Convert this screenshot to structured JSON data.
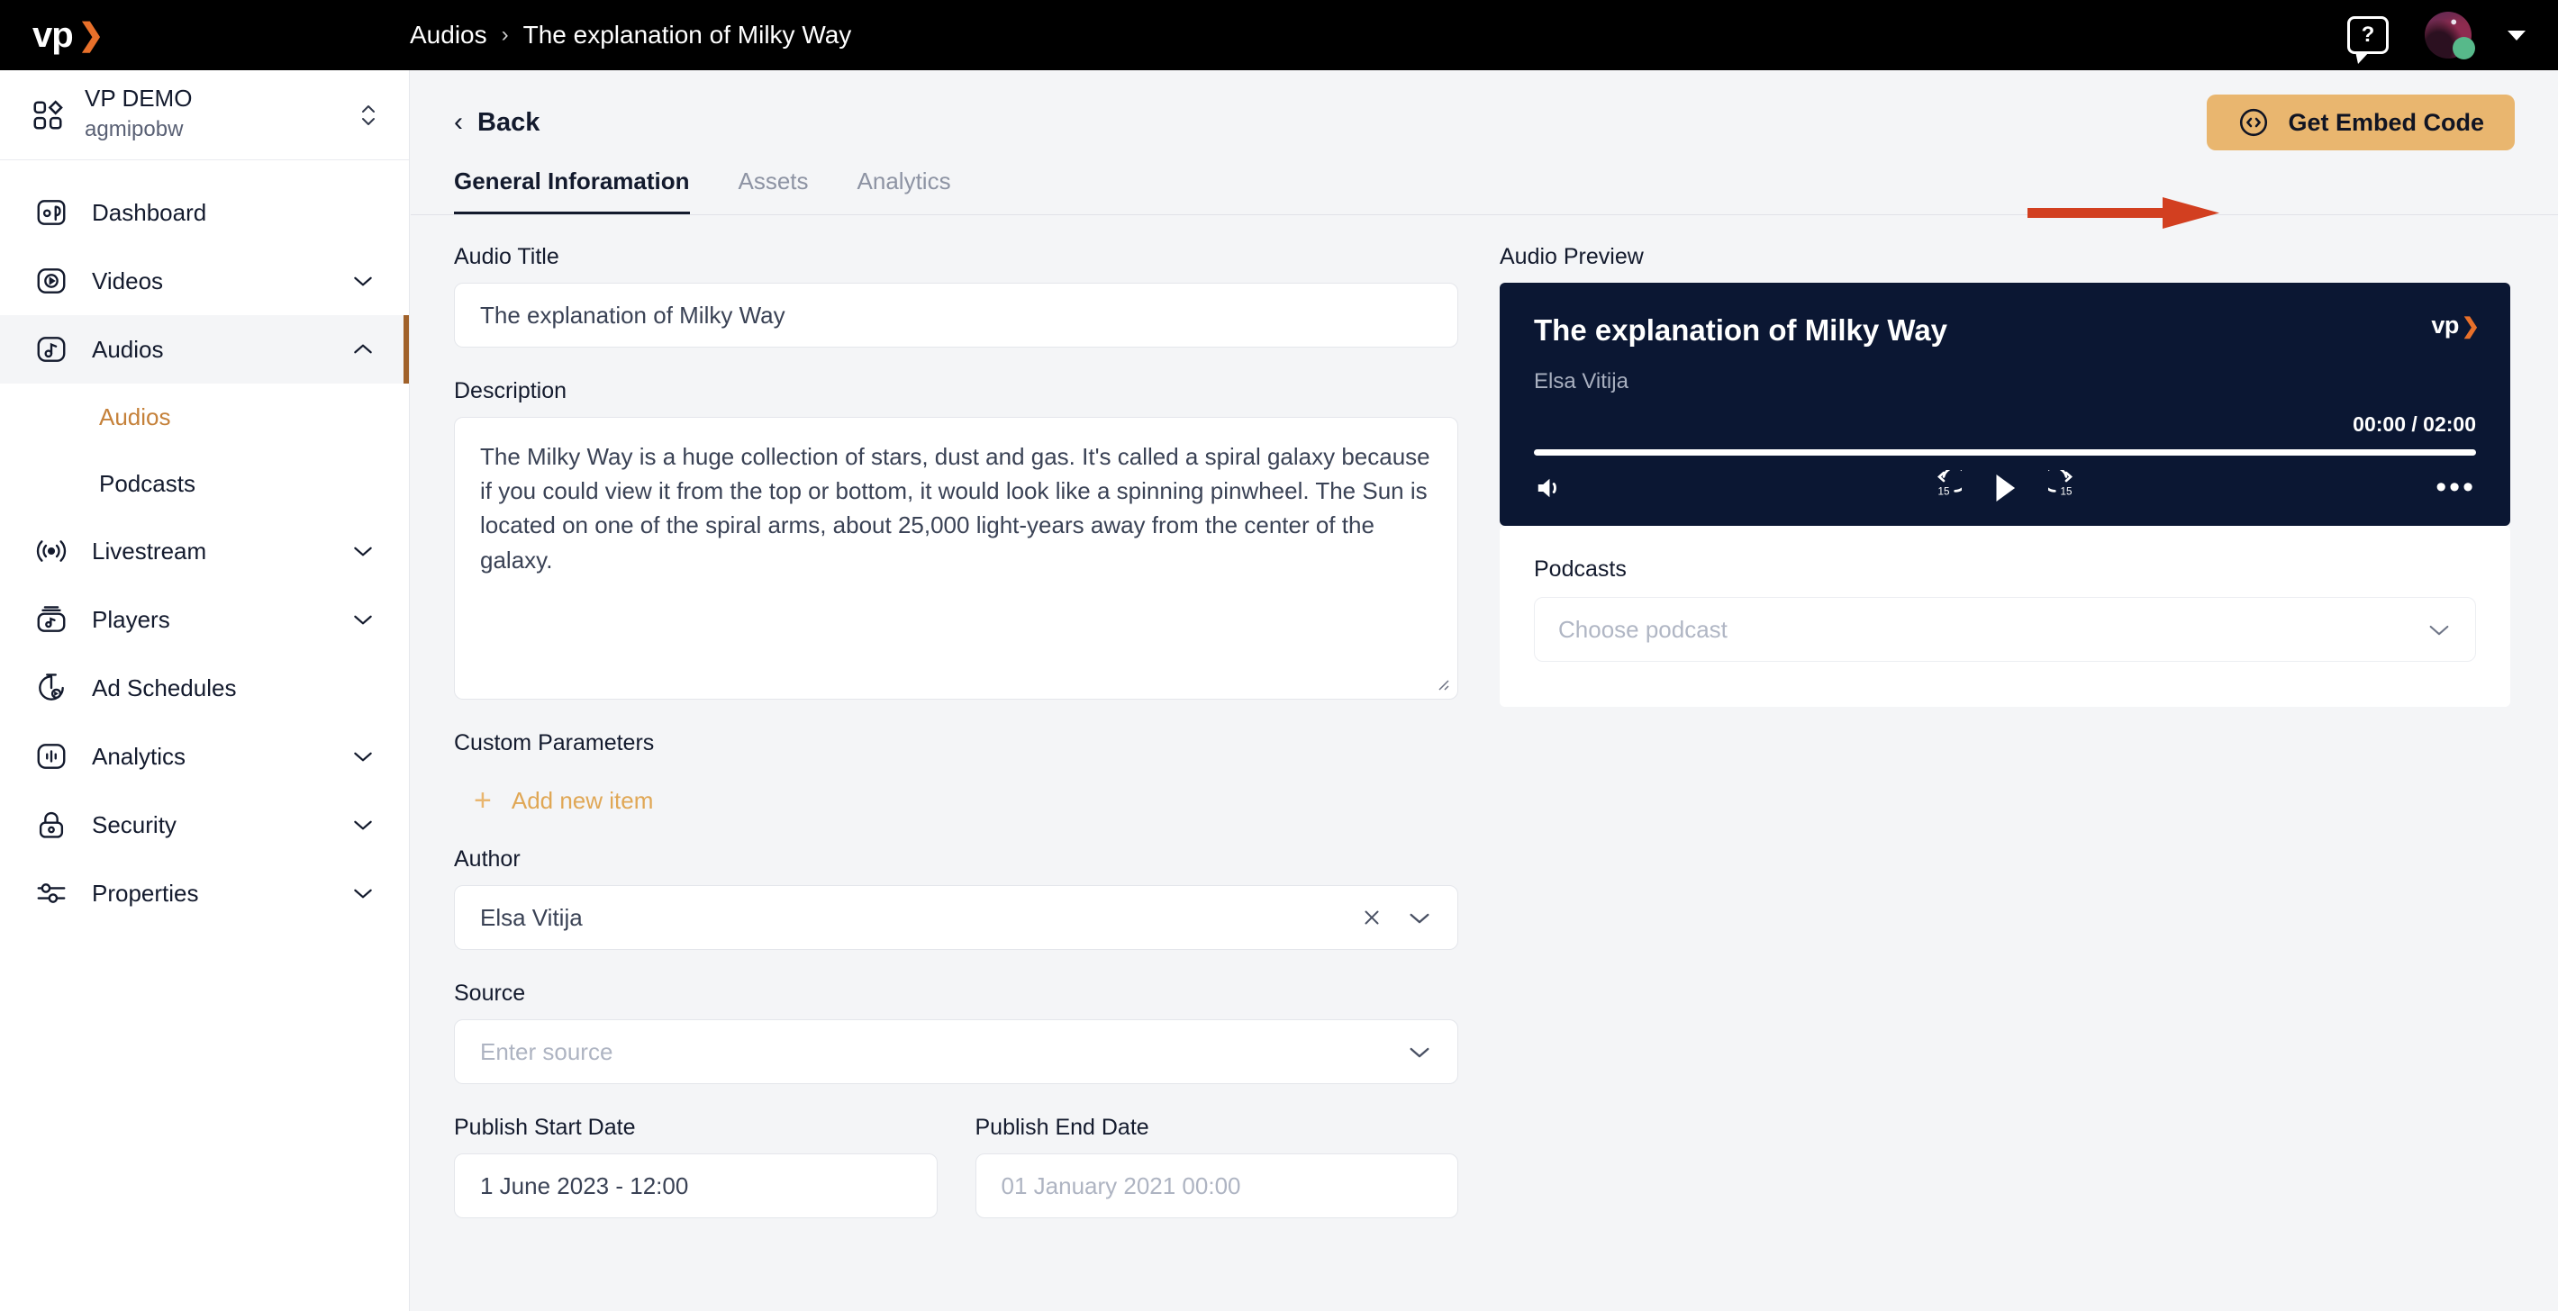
{
  "brand": {
    "logo_text": "vp",
    "logo_arrow": "❯",
    "accent_orange": "#e8702a",
    "accent_sand": "#e9b66f",
    "active_bar": "#a0612a",
    "player_bg": "#0b1733"
  },
  "topbar": {
    "breadcrumb_root": "Audios",
    "breadcrumb_separator": "›",
    "breadcrumb_current": "The explanation of Milky Way",
    "help_glyph": "?",
    "icons": [
      "help-icon",
      "avatar",
      "chevron-down-icon"
    ]
  },
  "sidebar": {
    "org_name": "VP DEMO",
    "org_id": "agmipobw",
    "items": [
      {
        "label": "Dashboard",
        "icon": "dashboard-icon",
        "expandable": false,
        "active": false
      },
      {
        "label": "Videos",
        "icon": "video-icon",
        "expandable": true,
        "expanded": false,
        "active": false
      },
      {
        "label": "Audios",
        "icon": "audio-icon",
        "expandable": true,
        "expanded": true,
        "active": true
      },
      {
        "label": "Livestream",
        "icon": "livestream-icon",
        "expandable": true,
        "expanded": false,
        "active": false
      },
      {
        "label": "Players",
        "icon": "players-icon",
        "expandable": true,
        "expanded": false,
        "active": false
      },
      {
        "label": "Ad Schedules",
        "icon": "ad-schedules-icon",
        "expandable": false,
        "active": false
      },
      {
        "label": "Analytics",
        "icon": "analytics-icon",
        "expandable": true,
        "expanded": false,
        "active": false
      },
      {
        "label": "Security",
        "icon": "security-icon",
        "expandable": true,
        "expanded": false,
        "active": false
      },
      {
        "label": "Properties",
        "icon": "properties-icon",
        "expandable": true,
        "expanded": false,
        "active": false
      }
    ],
    "audios_children": [
      {
        "label": "Audios",
        "active": true
      },
      {
        "label": "Podcasts",
        "active": false
      }
    ]
  },
  "main": {
    "back_label": "Back",
    "embed_button_label": "Get Embed Code",
    "tabs": [
      {
        "label": "General Inforamation",
        "active": true
      },
      {
        "label": "Assets",
        "active": false
      },
      {
        "label": "Analytics",
        "active": false
      }
    ]
  },
  "form": {
    "audio_title_label": "Audio Title",
    "audio_title_value": "The explanation of Milky Way",
    "description_label": "Description",
    "description_value": "The Milky Way is a huge collection of stars, dust and gas. It's called a spiral galaxy because if you could view it from the top or bottom, it would look like a spinning pinwheel. The Sun is located on one of the spiral arms, about 25,000 light-years away from the center of the galaxy.",
    "custom_parameters_label": "Custom Parameters",
    "add_new_item_label": "Add new item",
    "author_label": "Author",
    "author_value": "Elsa Vitija",
    "source_label": "Source",
    "source_placeholder": "Enter source",
    "publish_start_label": "Publish Start Date",
    "publish_start_value": "1 June 2023 - 12:00",
    "publish_end_label": "Publish End Date",
    "publish_end_placeholder": "01 January 2021 00:00"
  },
  "preview": {
    "label": "Audio Preview",
    "player_title": "The explanation of Milky Way",
    "player_author": "Elsa Vitija",
    "time_display": "00:00 / 02:00",
    "current_time": "00:00",
    "duration": "02:00",
    "progress_percent": 0,
    "rewind_seconds": "15",
    "forward_seconds": "15",
    "more_glyph": "•••"
  },
  "podcasts": {
    "label": "Podcasts",
    "select_placeholder": "Choose podcast"
  },
  "annotation": {
    "arrow_color": "#d23f20",
    "points_to": "Get Embed Code"
  }
}
